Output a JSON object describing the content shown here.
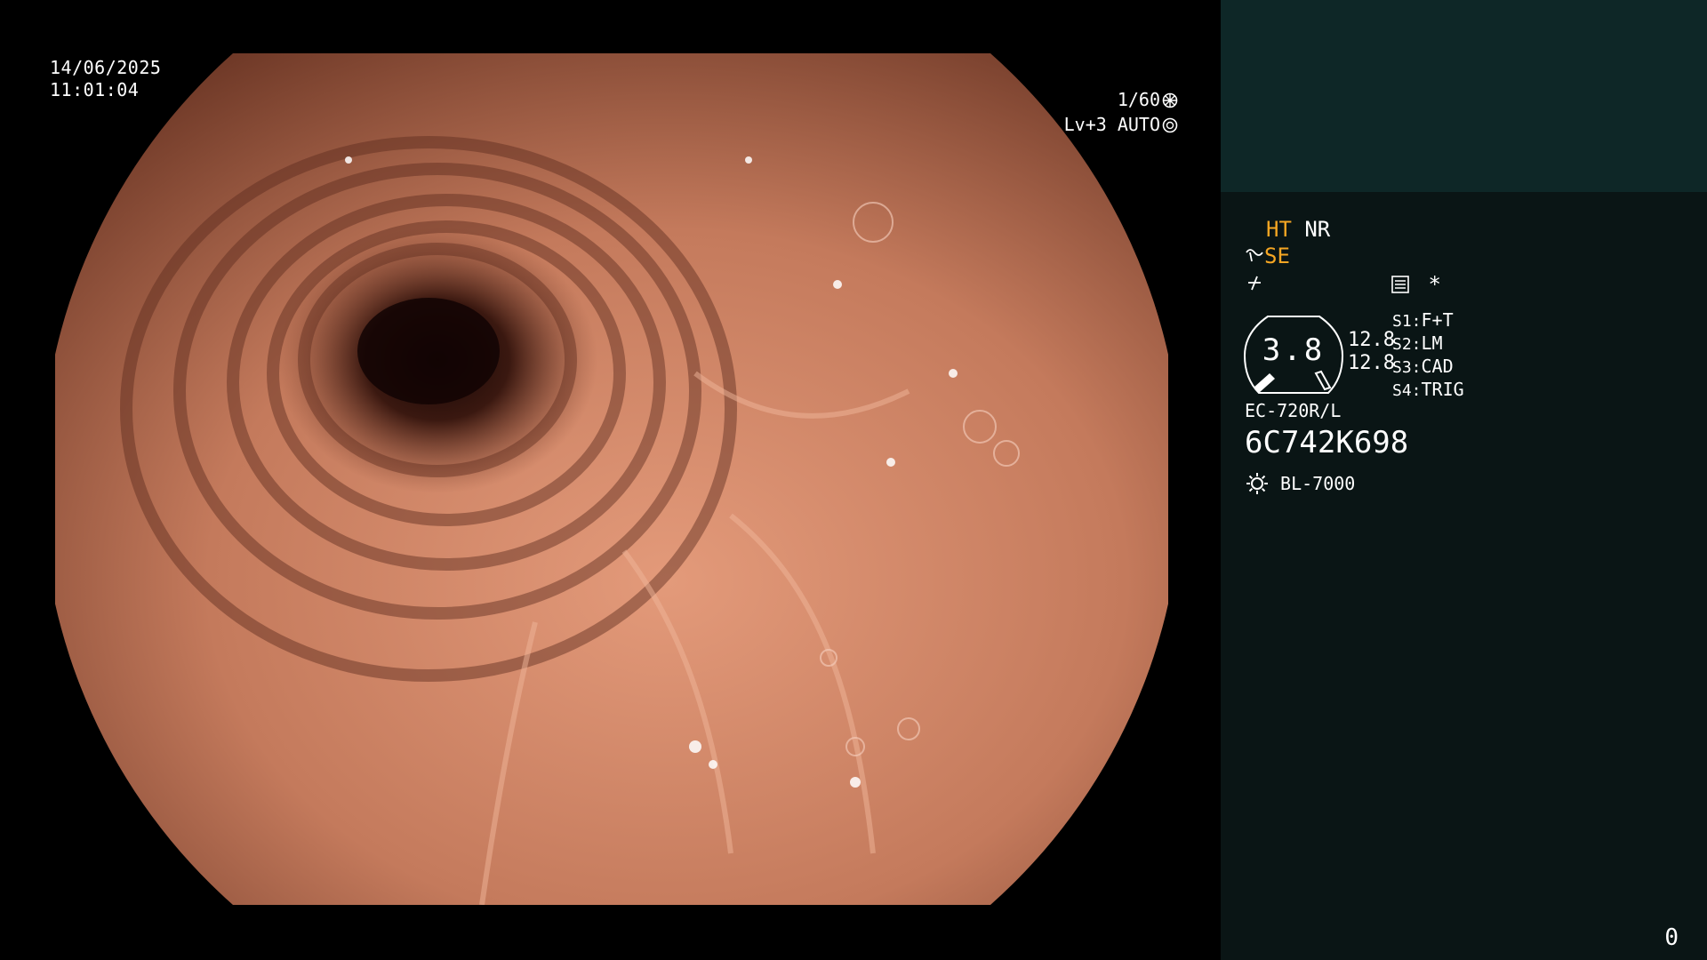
{
  "osd": {
    "date": "14/06/2025",
    "time": "11:01:04",
    "shutter": "1/60",
    "iris": "Lv+3 AUTO",
    "shutter_icon": "shutter-wheel-icon",
    "iris_icon": "iris-icon"
  },
  "panel": {
    "ht_label": "HT",
    "nr_label": "NR",
    "se_label": "SE",
    "se_icon": "structure-enhance-icon",
    "color_icon": "color-enhance-icon",
    "record_icon": "record-settings-icon",
    "asterisk": "*",
    "gauge_value": "3.8",
    "gauge_icon": "magnification-gauge-icon",
    "gauge_readout_1": "12.8",
    "gauge_readout_2": "12.8",
    "switches": [
      {
        "key": "S1:",
        "value": "F+T"
      },
      {
        "key": "S2:",
        "value": "LM"
      },
      {
        "key": "S3:",
        "value": "CAD"
      },
      {
        "key": "S4:",
        "value": "TRIG"
      }
    ],
    "scope_model": "EC-720R/L",
    "scope_serial": "6C742K698",
    "light_icon": "light-source-icon",
    "light_source": "BL-7000"
  },
  "page_number": "0",
  "colors": {
    "accent": "#f5a623",
    "panel_bg": "#0a1515",
    "preview_bg": "#0e2727"
  }
}
